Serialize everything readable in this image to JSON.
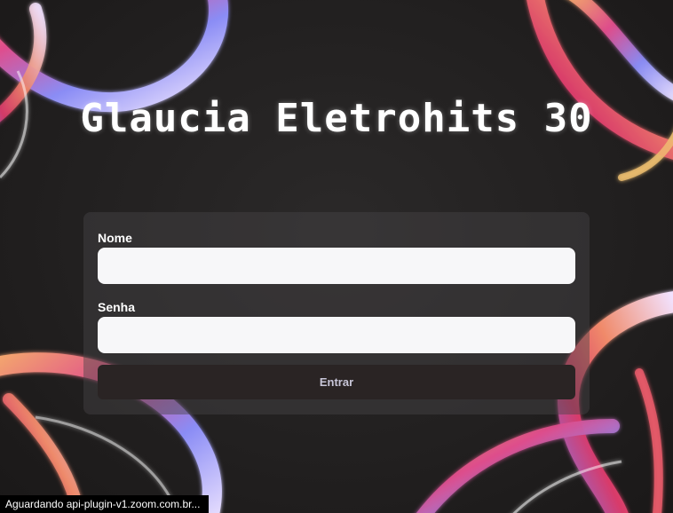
{
  "page": {
    "title": "Glaucia Eletrohits 30"
  },
  "form": {
    "name_label": "Nome",
    "name_value": "",
    "password_label": "Senha",
    "password_value": "",
    "submit_label": "Entrar"
  },
  "status_bar": {
    "text": "Aguardando api-plugin-v1.zoom.com.br..."
  },
  "colors": {
    "background": "#1f1d1d",
    "card": "#464446",
    "input": "#f7f7f9",
    "button": "#2a2424",
    "button_text": "#c8c6d8"
  }
}
